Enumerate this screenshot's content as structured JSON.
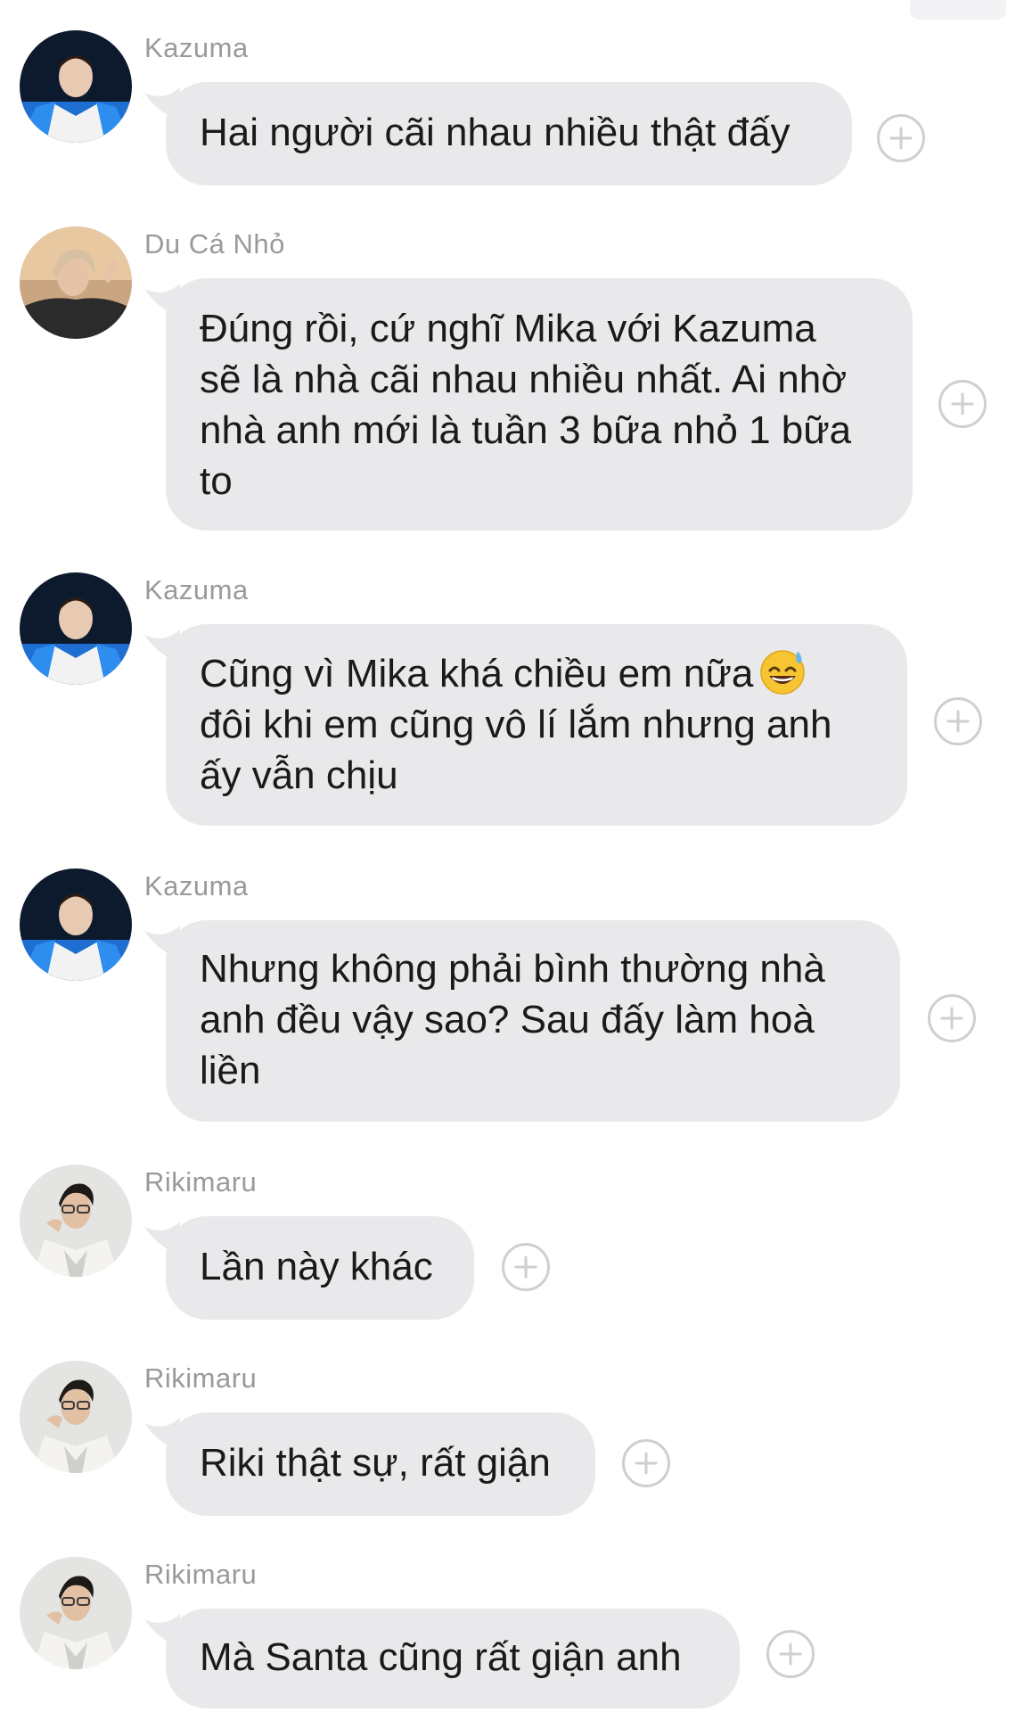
{
  "messages": [
    {
      "sender": "Kazuma",
      "avatar": "kazuma-avatar",
      "lines": [
        "Hai người cãi nhau nhiều thật đấy"
      ],
      "emoji": ""
    },
    {
      "sender": "Du Cá Nhỏ",
      "avatar": "du-ca-nho-avatar",
      "lines": [
        "Đúng rồi, cứ nghĩ Mika với Kazuma",
        "sẽ là nhà cãi nhau nhiều nhất. Ai nhờ",
        "nhà anh mới là tuần 3 bữa nhỏ 1 bữa",
        "to"
      ],
      "emoji": ""
    },
    {
      "sender": "Kazuma",
      "avatar": "kazuma-avatar",
      "lines": [
        "Cũng vì Mika khá chiều em nữa",
        "đôi khi em cũng vô lí lắm nhưng anh",
        "ấy vẫn chịu"
      ],
      "emoji": "grinning-sweat-emoji"
    },
    {
      "sender": "Kazuma",
      "avatar": "kazuma-avatar",
      "lines": [
        "Nhưng không phải bình thường nhà",
        "anh đều vậy sao? Sau đấy làm hoà",
        "liền"
      ],
      "emoji": ""
    },
    {
      "sender": "Rikimaru",
      "avatar": "rikimaru-avatar",
      "lines": [
        "Lần này khác"
      ],
      "emoji": ""
    },
    {
      "sender": "Rikimaru",
      "avatar": "rikimaru-avatar",
      "lines": [
        "Riki thật sự, rất giận"
      ],
      "emoji": ""
    },
    {
      "sender": "Rikimaru",
      "avatar": "rikimaru-avatar",
      "lines": [
        "Mà Santa cũng rất giận anh"
      ],
      "emoji": ""
    }
  ],
  "react_icon": "plus-icon",
  "colors": {
    "bubble": "#e9e9eb",
    "sender_text": "#9a9a9a",
    "message_text": "#1a1a1a",
    "react_border": "#cfcfd3"
  }
}
